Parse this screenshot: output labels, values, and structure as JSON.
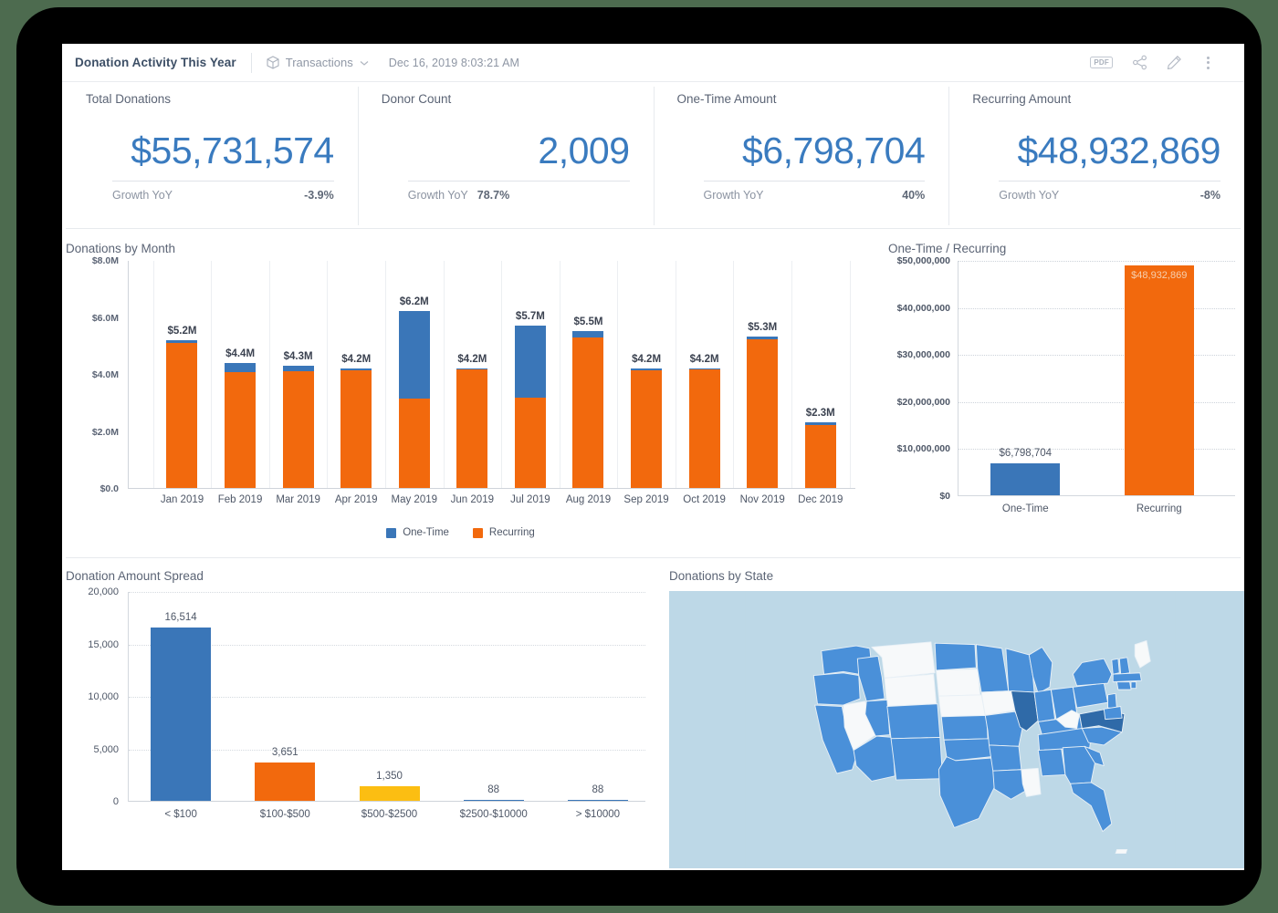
{
  "header": {
    "title": "Donation Activity This Year",
    "source_label": "Transactions",
    "source_icon": "cube-icon",
    "chevron_icon": "chevron-down-icon",
    "timestamp": "Dec 16, 2019 8:03:21 AM",
    "actions": [
      {
        "name": "export-pdf-button",
        "label": "PDF"
      },
      {
        "name": "share-button",
        "label": "share-icon"
      },
      {
        "name": "edit-button",
        "label": "pencil-icon"
      },
      {
        "name": "more-options-button",
        "label": "kebab-icon"
      }
    ]
  },
  "kpis": [
    {
      "label": "Total Donations",
      "value": "$55,731,574",
      "growth_label": "Growth YoY",
      "growth_value": "-3.9%"
    },
    {
      "label": "Donor Count",
      "value": "2,009",
      "growth_label": "Growth YoY",
      "growth_value": "78.7%"
    },
    {
      "label": "One-Time Amount",
      "value": "$6,798,704",
      "growth_label": "Growth YoY",
      "growth_value": "40%"
    },
    {
      "label": "Recurring Amount",
      "value": "$48,932,869",
      "growth_label": "Growth YoY",
      "growth_value": "-8%"
    }
  ],
  "colors": {
    "one_time_blue": "#3a76b8",
    "recurring_orange": "#f2690d",
    "spread_yellow": "#fcbe12",
    "kpi_blue": "#3a7bbf",
    "map_bg": "#bdd8e7",
    "map_state": "#4a90d9",
    "map_state_high": "#2f6aa8",
    "map_state_none": "#f7f9fa"
  },
  "chart_data": [
    {
      "type": "bar",
      "name": "donations-by-month",
      "title": "Donations by Month",
      "stacked": true,
      "xlabel": "",
      "ylabel": "",
      "ylim": [
        0,
        8000000
      ],
      "ytick_labels": [
        "$0.0",
        "$2.0M",
        "$4.0M",
        "$6.0M",
        "$8.0M"
      ],
      "ytick_values": [
        0,
        2000000,
        4000000,
        6000000,
        8000000
      ],
      "grid": true,
      "legend": [
        "One-Time",
        "Recurring"
      ],
      "legend_position": "bottom",
      "categories": [
        "Jan 2019",
        "Feb 2019",
        "Mar 2019",
        "Apr 2019",
        "May 2019",
        "Jun 2019",
        "Jul 2019",
        "Aug 2019",
        "Sep 2019",
        "Oct 2019",
        "Nov 2019",
        "Dec 2019"
      ],
      "series": [
        {
          "name": "Recurring",
          "color": "#f2690d",
          "values": [
            5080000,
            4060000,
            4110000,
            4140000,
            3130000,
            4170000,
            3180000,
            5280000,
            4140000,
            4150000,
            5230000,
            2200000
          ]
        },
        {
          "name": "One-Time",
          "color": "#3a76b8",
          "values": [
            120000,
            340000,
            190000,
            60000,
            3070000,
            30000,
            2520000,
            220000,
            60000,
            50000,
            70000,
            100000
          ]
        }
      ],
      "totals_labels": [
        "$5.2M",
        "$4.4M",
        "$4.3M",
        "$4.2M",
        "$6.2M",
        "$4.2M",
        "$5.7M",
        "$5.5M",
        "$4.2M",
        "$4.2M",
        "$5.3M",
        "$2.3M"
      ]
    },
    {
      "type": "bar",
      "name": "one-time-vs-recurring",
      "title": "One-Time / Recurring",
      "xlabel": "",
      "ylabel": "",
      "ylim": [
        0,
        50000000
      ],
      "ytick_labels": [
        "$0",
        "$10,000,000",
        "$20,000,000",
        "$30,000,000",
        "$40,000,000",
        "$50,000,000"
      ],
      "ytick_values": [
        0,
        10000000,
        20000000,
        30000000,
        40000000,
        50000000
      ],
      "grid": true,
      "categories": [
        "One-Time",
        "Recurring"
      ],
      "values": [
        6798704,
        48932869
      ],
      "value_labels": [
        "$6,798,704",
        "$48,932,869"
      ],
      "bar_colors": [
        "#3a76b8",
        "#f2690d"
      ]
    },
    {
      "type": "bar",
      "name": "donation-amount-spread",
      "title": "Donation Amount Spread",
      "xlabel": "",
      "ylabel": "",
      "ylim": [
        0,
        20000
      ],
      "ytick_labels": [
        "0",
        "5,000",
        "10,000",
        "15,000",
        "20,000"
      ],
      "ytick_values": [
        0,
        5000,
        10000,
        15000,
        20000
      ],
      "grid": true,
      "categories": [
        "< $100",
        "$100-$500",
        "$500-$2500",
        "$2500-$10000",
        "> $10000"
      ],
      "values": [
        16514,
        3651,
        1350,
        88,
        88
      ],
      "value_labels": [
        "16,514",
        "3,651",
        "1,350",
        "88",
        "88"
      ],
      "bar_colors": [
        "#3a76b8",
        "#f2690d",
        "#fcbe12",
        "#3a76b8",
        "#3a76b8"
      ]
    },
    {
      "type": "heatmap",
      "name": "donations-by-state",
      "title": "Donations by State",
      "subtype": "choropleth-us-states",
      "legend": [],
      "high_states": [
        "VA",
        "IL"
      ],
      "no_data_states": [
        "MT",
        "WY",
        "SD",
        "NE",
        "IA",
        "NV",
        "WV",
        "MS",
        "ME"
      ],
      "note": "All other states shaded medium blue"
    }
  ]
}
